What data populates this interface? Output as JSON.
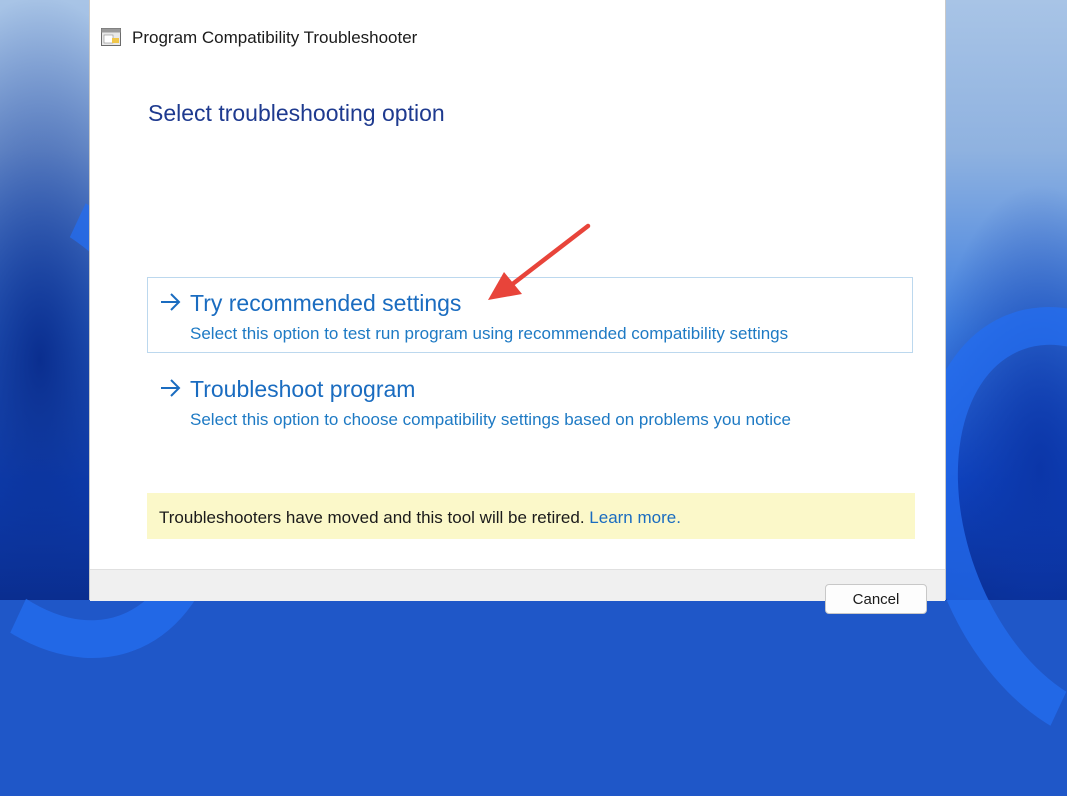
{
  "window": {
    "title": "Program Compatibility Troubleshooter",
    "icon": "troubleshooter-app-icon"
  },
  "main": {
    "heading": "Select troubleshooting option",
    "options": [
      {
        "title": "Try recommended settings",
        "description": "Select this option to test run program using recommended compatibility settings",
        "selected": true
      },
      {
        "title": "Troubleshoot program",
        "description": "Select this option to choose compatibility settings based on problems you notice",
        "selected": false
      }
    ]
  },
  "notice": {
    "text": "Troubleshooters have moved and this tool will be retired.",
    "link": "Learn more."
  },
  "footer": {
    "cancel_label": "Cancel"
  },
  "annotation": {
    "color": "#e8443a"
  }
}
